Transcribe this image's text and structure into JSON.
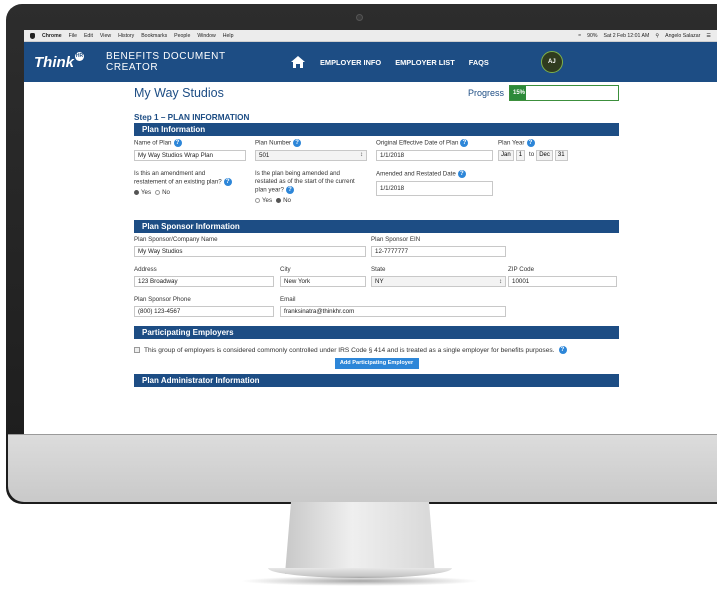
{
  "menubar": {
    "app": "Chrome",
    "items": [
      "File",
      "Edit",
      "View",
      "History",
      "Bookmarks",
      "People",
      "Window",
      "Help"
    ],
    "battery": "90%",
    "datetime": "Sat 2 Feb 12:01 AM",
    "user": "Angelo Salazar"
  },
  "nav": {
    "logo": "Think",
    "logo_badge": "HR",
    "app_name": "BENEFITS DOCUMENT CREATOR",
    "links": [
      "EMPLOYER INFO",
      "EMPLOYER LIST",
      "FAQS"
    ],
    "avatar": "AJ"
  },
  "header": {
    "company": "My Way Studios",
    "progress_label": "Progress",
    "progress_value": "15%",
    "progress_fraction": 0.15
  },
  "step_title": "Step 1 – PLAN INFORMATION",
  "sections": {
    "plan_info": "Plan Information",
    "sponsor_info": "Plan Sponsor Information",
    "participating": "Participating Employers",
    "administrator": "Plan Administrator Information"
  },
  "plan": {
    "name_label": "Name of Plan",
    "name_value": "My Way Studios Wrap Plan",
    "number_label": "Plan Number",
    "number_value": "501",
    "effective_label": "Original Effective Date of Plan",
    "effective_value": "1/1/2018",
    "year_label": "Plan Year",
    "year_from_month": "Jan",
    "year_from_day": "1",
    "year_to": "to",
    "year_to_month": "Dec",
    "year_to_day": "31",
    "amend_label_1": "Is this an amendment and",
    "amend_label_2": "restatement of an existing plan?",
    "restated_label_1": "Is the plan being amended and",
    "restated_label_2": "restated as of the start of the current",
    "restated_label_3": "plan year?",
    "yes": "Yes",
    "no": "No",
    "amended_date_label": "Amended and Restated Date",
    "amended_date_value": "1/1/2018"
  },
  "sponsor": {
    "company_label": "Plan Sponsor/Company Name",
    "company_value": "My Way Studios",
    "ein_label": "Plan Sponsor EIN",
    "ein_value": "12-7777777",
    "address_label": "Address",
    "address_value": "123 Broadway",
    "city_label": "City",
    "city_value": "New York",
    "state_label": "State",
    "state_value": "NY",
    "zip_label": "ZIP Code",
    "zip_value": "10001",
    "phone_label": "Plan Sponsor Phone",
    "phone_value": "(800) 123-4567",
    "email_label": "Email",
    "email_value": "franksinatra@thinkhr.com"
  },
  "participating": {
    "text": "This group of employers is considered commonly controlled under IRS Code § 414 and is treated as a single employer for benefits purposes.",
    "button": "Add Participating Employer"
  }
}
